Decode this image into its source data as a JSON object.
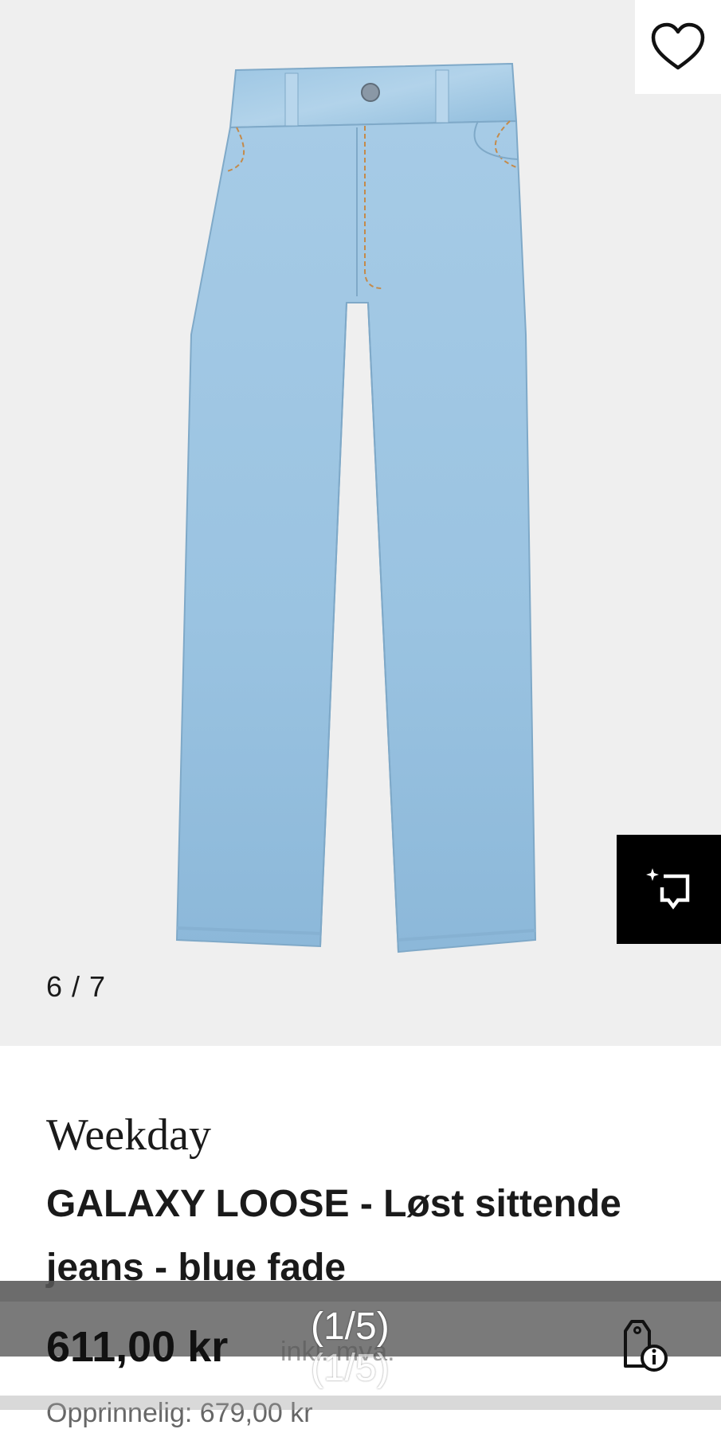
{
  "gallery": {
    "counter": "6 / 7",
    "wishlist_icon": "heart-outline-icon",
    "similar_icon": "find-similar-icon",
    "image_subject": "light-wash loose jeans"
  },
  "product": {
    "brand": "Weekday",
    "title": "GALAXY LOOSE - Løst sittende jeans - blue fade",
    "price": "611,00 kr",
    "vat_note": "inkl. mva.",
    "original_price": "Opprinnelig: 679,00 kr",
    "price_info_icon": "price-tag-info-icon"
  },
  "overlay": {
    "media_counter": "(1/5)"
  },
  "colors": {
    "denim_light": "#a9cde6",
    "denim_mid": "#8dbbdc",
    "background": "#efefef",
    "text": "#1a1a1a"
  }
}
